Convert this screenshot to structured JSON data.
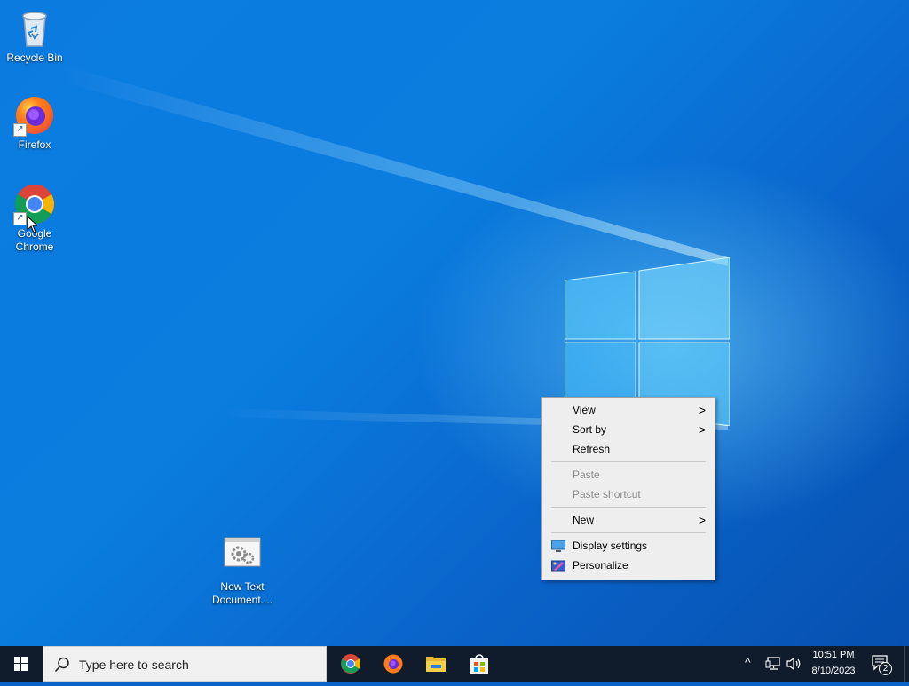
{
  "desktop": {
    "icons": [
      {
        "label": "Recycle Bin"
      },
      {
        "label": "Firefox"
      },
      {
        "label": "Google Chrome"
      },
      {
        "label": "New Text Document...."
      }
    ]
  },
  "context_menu": {
    "items": [
      {
        "label": "View",
        "submenu": true,
        "enabled": true
      },
      {
        "label": "Sort by",
        "submenu": true,
        "enabled": true
      },
      {
        "label": "Refresh",
        "enabled": true
      },
      {
        "label": "Paste",
        "enabled": false
      },
      {
        "label": "Paste shortcut",
        "enabled": false
      },
      {
        "label": "New",
        "submenu": true,
        "enabled": true
      },
      {
        "label": "Display settings",
        "icon": "display-icon",
        "enabled": true
      },
      {
        "label": "Personalize",
        "icon": "personalize-icon",
        "enabled": true
      }
    ],
    "arrow_glyph": ">"
  },
  "taskbar": {
    "search_placeholder": "Type here to search",
    "pinned": [
      "chrome-icon",
      "firefox-icon",
      "file-explorer-icon",
      "store-icon"
    ],
    "clock_time": "10:51 PM",
    "clock_date": "8/10/2023",
    "notification_count": "2",
    "tray_chevron": "^"
  },
  "colors": {
    "taskbar": "#101c2b",
    "menu_bg": "#eeeeee",
    "disabled_text": "#8a8a8a"
  }
}
